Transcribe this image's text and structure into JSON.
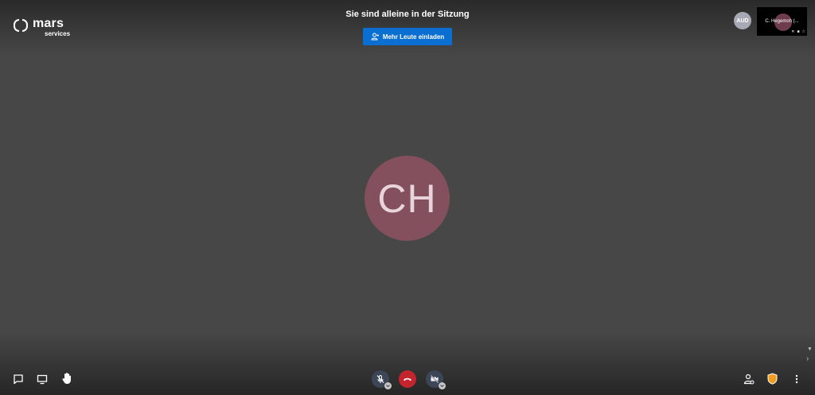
{
  "brand": {
    "word": "mars",
    "sub": "services"
  },
  "header": {
    "notice": "Sie sind alleine in der Sitzung",
    "invite_label": "Mehr Leute einladen"
  },
  "participants": {
    "small_avatar_initials": "AUD",
    "thumbnail_name": "C. Hegemoh (..."
  },
  "main": {
    "initials": "CH"
  },
  "colors": {
    "background": "#474747",
    "accent": "#0b6fd1",
    "hangup": "#c4242c",
    "avatar": "#84505e",
    "shield": "#f39b1d"
  },
  "toolbar": {
    "left": [
      "chat-icon",
      "screen-share-icon",
      "raise-hand-icon"
    ],
    "center": [
      "microphone-muted-icon",
      "hangup-icon",
      "camera-off-icon"
    ],
    "right": [
      "invite-icon",
      "security-shield-icon",
      "more-options-icon"
    ]
  }
}
